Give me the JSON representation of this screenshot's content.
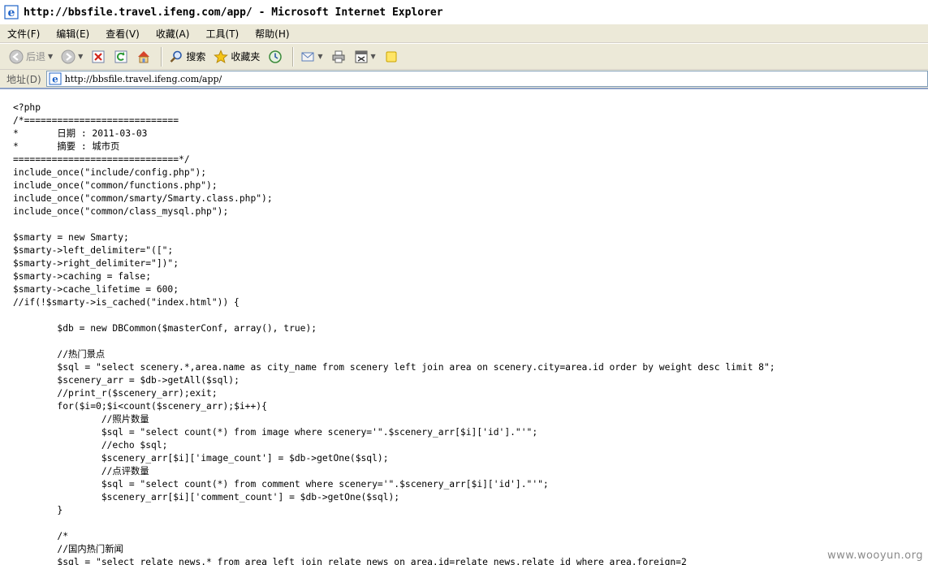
{
  "window": {
    "title": "http://bbsfile.travel.ifeng.com/app/ - Microsoft Internet Explorer"
  },
  "menu": {
    "items": [
      {
        "label": "文件",
        "key": "(F)"
      },
      {
        "label": "编辑",
        "key": "(E)"
      },
      {
        "label": "查看",
        "key": "(V)"
      },
      {
        "label": "收藏",
        "key": "(A)"
      },
      {
        "label": "工具",
        "key": "(T)"
      },
      {
        "label": "帮助",
        "key": "(H)"
      }
    ]
  },
  "toolbar": {
    "back_label": "后退",
    "search_label": "搜索",
    "favorites_label": "收藏夹"
  },
  "address": {
    "label": "地址",
    "key": "(D)",
    "url": "http://bbsfile.travel.ifeng.com/app/"
  },
  "content": {
    "code": "<?php\n/*============================\n*\t日期 : 2011-03-03\n*\t摘要 : 城市页\n==============================*/\ninclude_once(\"include/config.php\");\ninclude_once(\"common/functions.php\");\ninclude_once(\"common/smarty/Smarty.class.php\");\ninclude_once(\"common/class_mysql.php\");\n\n$smarty = new Smarty;\n$smarty->left_delimiter=\"([\";\n$smarty->right_delimiter=\"])\";\n$smarty->caching = false;\n$smarty->cache_lifetime = 600;\n//if(!$smarty->is_cached(\"index.html\")) {\n\n\t$db = new DBCommon($masterConf, array(), true);\n\n\t//热门景点\n\t$sql = \"select scenery.*,area.name as city_name from scenery left join area on scenery.city=area.id order by weight desc limit 8\";\n\t$scenery_arr = $db->getAll($sql);\n\t//print_r($scenery_arr);exit;\n\tfor($i=0;$i<count($scenery_arr);$i++){\n\t\t//照片数量\n\t\t$sql = \"select count(*) from image where scenery='\".$scenery_arr[$i]['id'].\"'\";\n\t\t//echo $sql;\n\t\t$scenery_arr[$i]['image_count'] = $db->getOne($sql);\n\t\t//点评数量\n\t\t$sql = \"select count(*) from comment where scenery='\".$scenery_arr[$i]['id'].\"'\";\n\t\t$scenery_arr[$i]['comment_count'] = $db->getOne($sql);\n\t}\n\n\t/*\n\t//国内热门新闻\n\t$sql = \"select relate_news.* from area left join relate_news on area.id=relate_news.relate_id where area.foreign=2 "
  },
  "watermark": "www.wooyun.org",
  "colors": {
    "chrome_bg": "#ece9d8",
    "address_border": "#7f9db9",
    "ie_blue": "#1f63c7"
  }
}
